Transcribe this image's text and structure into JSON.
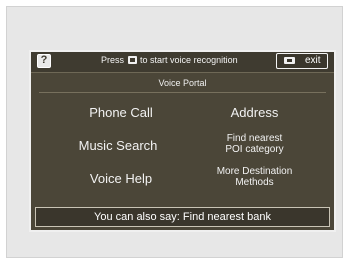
{
  "topbar": {
    "home_icon": "voice-command-icon",
    "home_glyph": "?",
    "prompt_before": "Press",
    "prompt_key_icon": "talk-button-icon",
    "prompt_after": "to start voice recognition",
    "exit_icon": "back-button-icon",
    "exit_label": "exit"
  },
  "portal": {
    "title": "Voice Portal"
  },
  "menu": {
    "phone_call": "Phone Call",
    "address": "Address",
    "music_search": "Music Search",
    "find_nearest_line1": "Find nearest",
    "find_nearest_line2": "POI category",
    "voice_help": "Voice Help",
    "more_dest_line1": "More Destination",
    "more_dest_line2": "Methods"
  },
  "hint": {
    "text": "You can also say: Find nearest bank"
  },
  "colors": {
    "screen_bg": "#4b4638",
    "bar_bg": "#3f3b30",
    "text": "#f2f2f2"
  }
}
